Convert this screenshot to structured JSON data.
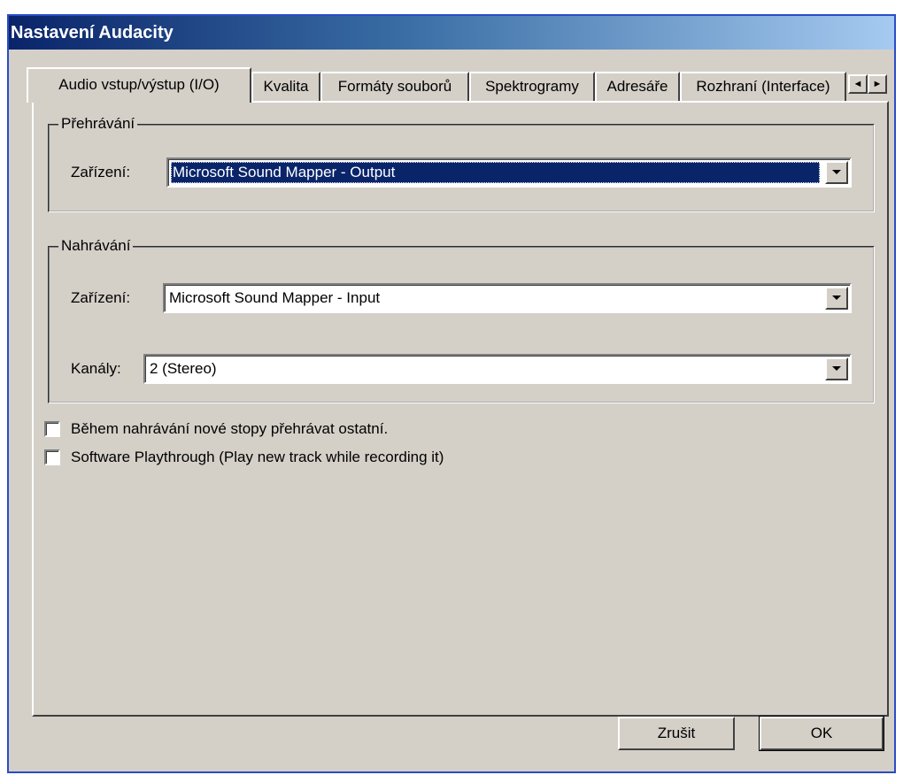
{
  "window": {
    "title": "Nastavení Audacity"
  },
  "tabs": [
    {
      "label": "Audio vstup/výstup (I/O)",
      "active": true
    },
    {
      "label": "Kvalita",
      "active": false
    },
    {
      "label": "Formáty souborů",
      "active": false
    },
    {
      "label": "Spektrogramy",
      "active": false
    },
    {
      "label": "Adresáře",
      "active": false
    },
    {
      "label": "Rozhraní (Interface)",
      "active": false
    }
  ],
  "tab_scroll": {
    "left_icon": "triangle-left-icon",
    "right_icon": "triangle-right-icon"
  },
  "playback": {
    "group_title": "Přehrávání",
    "device_label": "Zařízení:",
    "device_value": "Microsoft Sound Mapper - Output"
  },
  "recording": {
    "group_title": "Nahrávání",
    "device_label": "Zařízení:",
    "device_value": "Microsoft Sound Mapper - Input",
    "channels_label": "Kanály:",
    "channels_value": "2 (Stereo)"
  },
  "options": [
    {
      "label": "Během nahrávání nové stopy přehrávat ostatní.",
      "checked": false
    },
    {
      "label": "Software Playthrough (Play new track while recording it)",
      "checked": false
    }
  ],
  "buttons": {
    "cancel": "Zrušit",
    "ok": "OK"
  },
  "colors": {
    "title_bar": "#0a246a",
    "dialog_face": "#d4d0c8",
    "selection": "#0a246a"
  }
}
